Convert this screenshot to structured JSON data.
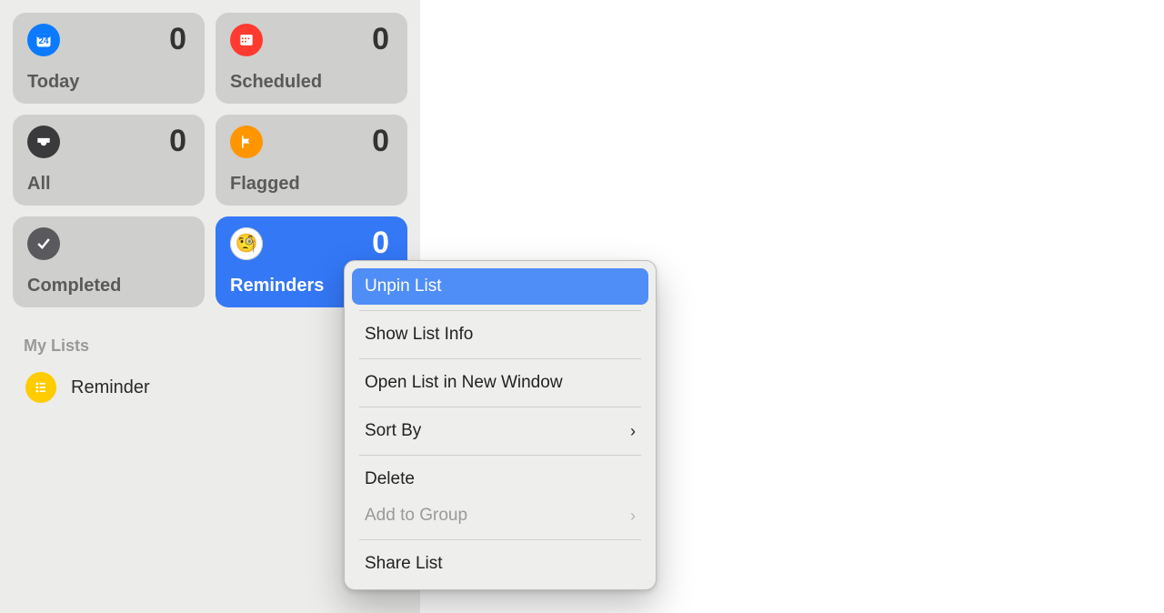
{
  "sidebar": {
    "cards": {
      "today": {
        "label": "Today",
        "count": 0,
        "daynum": "24"
      },
      "scheduled": {
        "label": "Scheduled",
        "count": 0
      },
      "all": {
        "label": "All",
        "count": 0
      },
      "flagged": {
        "label": "Flagged",
        "count": 0
      },
      "completed": {
        "label": "Completed"
      },
      "reminders": {
        "label": "Reminders",
        "count": 0
      }
    },
    "my_lists_header": "My Lists",
    "lists": [
      {
        "label": "Reminder"
      }
    ]
  },
  "context_menu": {
    "items": {
      "unpin": {
        "label": "Unpin List"
      },
      "info": {
        "label": "Show List Info"
      },
      "open_window": {
        "label": "Open List in New Window"
      },
      "sort_by": {
        "label": "Sort By"
      },
      "delete": {
        "label": "Delete"
      },
      "add_group": {
        "label": "Add to Group"
      },
      "share": {
        "label": "Share List"
      }
    }
  },
  "colors": {
    "accent_blue": "#3478f6",
    "today_blue": "#0a7aff",
    "scheduled_red": "#ff3b30",
    "flagged_orange": "#ff9500",
    "list_yellow": "#ffcc00"
  }
}
